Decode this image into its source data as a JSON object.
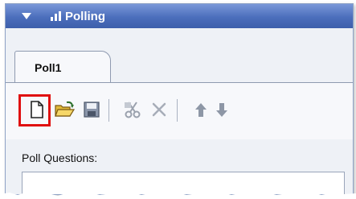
{
  "panel": {
    "title": "Polling",
    "colors": {
      "header_top": "#7a98d8",
      "header_bottom": "#3d5fab",
      "highlight": "#e01010"
    }
  },
  "tabs": [
    {
      "label": "Poll1",
      "selected": true
    }
  ],
  "toolbar": {
    "buttons": [
      {
        "icon": "new-document-icon",
        "selected": true
      },
      {
        "icon": "open-folder-icon"
      },
      {
        "icon": "save-disk-icon"
      },
      {
        "icon": "cut-scissors-icon"
      },
      {
        "icon": "delete-x-icon"
      },
      {
        "icon": "move-up-arrow-icon"
      },
      {
        "icon": "move-down-arrow-icon"
      }
    ]
  },
  "questions": {
    "label": "Poll Questions:"
  }
}
